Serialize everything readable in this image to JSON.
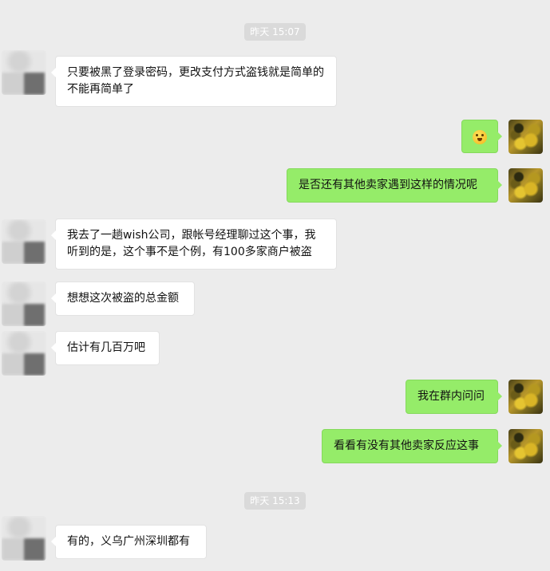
{
  "timestamps": [
    "昨天 15:07",
    "昨天 15:13"
  ],
  "messages": [
    {
      "side": "in",
      "text": "只要被黑了登录密码，更改支付方式盗钱就是简单的不能再简单了"
    },
    {
      "side": "out",
      "emoji": "emoji-face"
    },
    {
      "side": "out",
      "text": "是否还有其他卖家遇到这样的情况呢"
    },
    {
      "side": "in",
      "text": "我去了一趟wish公司，跟帐号经理聊过这个事，我听到的是，这个事不是个例，有100多家商户被盗"
    },
    {
      "side": "in",
      "text": "想想这次被盗的总金额"
    },
    {
      "side": "in",
      "text": "估计有几百万吧"
    },
    {
      "side": "out",
      "text": "我在群内问问"
    },
    {
      "side": "out",
      "text": "看看有没有其他卖家反应这事"
    },
    {
      "side": "in",
      "text": "有的，义乌广州深圳都有"
    }
  ],
  "colors": {
    "background": "#ececec",
    "incoming_bubble": "#ffffff",
    "outgoing_bubble": "#95ec69",
    "timestamp_bg": "#dadada"
  }
}
